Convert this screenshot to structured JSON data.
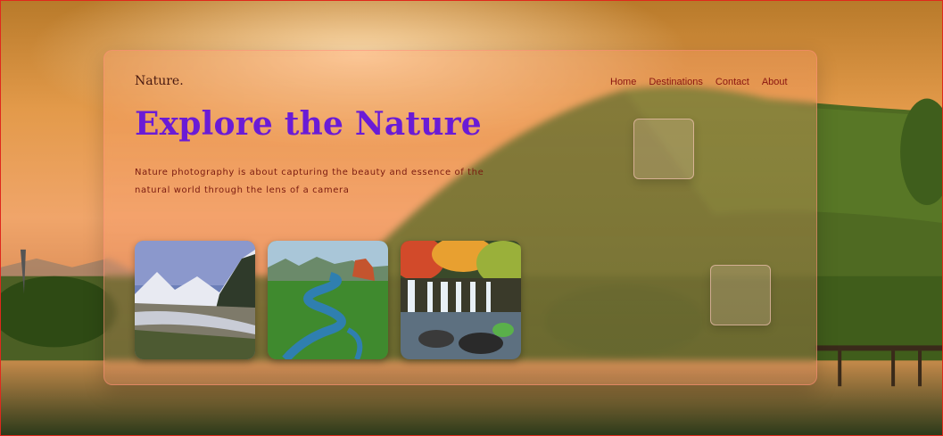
{
  "brand": "Nature.",
  "nav": {
    "items": [
      {
        "label": "Home"
      },
      {
        "label": "Destinations"
      },
      {
        "label": "Contact"
      },
      {
        "label": "About"
      }
    ]
  },
  "hero": {
    "title": "Explore the Nature",
    "description": "Nature photography is about capturing the beauty and essence of the natural world through the lens of a camera"
  },
  "gallery": {
    "images": [
      {
        "subject": "snowy mountain valley with river"
      },
      {
        "subject": "winding river through green landscape"
      },
      {
        "subject": "waterfall with autumn trees"
      }
    ]
  },
  "colors": {
    "title": "#6a1bd6",
    "nav_text": "#8a1510",
    "frame_border": "#e0281c"
  }
}
